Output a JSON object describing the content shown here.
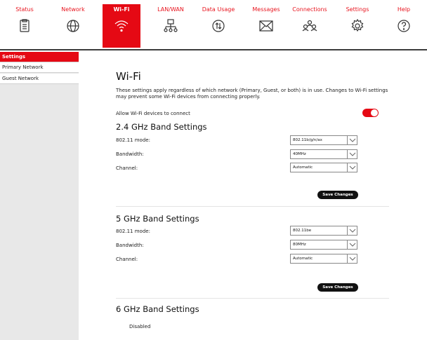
{
  "nav": {
    "status": "Status",
    "network": "Network",
    "wifi": "Wi-Fi",
    "lanwan": "LAN/WAN",
    "data_usage": "Data Usage",
    "messages": "Messages",
    "connections": "Connections",
    "settings": "Settings",
    "help": "Help",
    "accent_color": "#e50914"
  },
  "sidebar": {
    "items": [
      {
        "label": "Settings"
      },
      {
        "label": "Primary Network"
      },
      {
        "label": "Guest Network"
      }
    ]
  },
  "main": {
    "title": "Wi-Fi",
    "intro": "These settings apply regardless of which network (Primary, Guest, or both) is in use. Changes to Wi-Fi settings may prevent some Wi-Fi devices from connecting properly.",
    "allow_label": "Allow Wi-Fi devices to connect",
    "allow_enabled": true,
    "band24": {
      "title": "2.4 GHz Band Settings",
      "mode_label": "802.11 mode:",
      "mode_value": "802.11b/g/n/ax",
      "bandwidth_label": "Bandwidth:",
      "bandwidth_value": "40MHz",
      "channel_label": "Channel:",
      "channel_value": "Automatic",
      "save_label": "Save Changes"
    },
    "band5": {
      "title": "5 GHz Band Settings",
      "mode_label": "802.11 mode:",
      "mode_value": "802.11be",
      "bandwidth_label": "Bandwidth:",
      "bandwidth_value": "80MHz",
      "channel_label": "Channel:",
      "channel_value": "Automatic",
      "save_label": "Save Changes"
    },
    "band6": {
      "title": "6 GHz Band Settings",
      "status": "Disabled"
    }
  }
}
